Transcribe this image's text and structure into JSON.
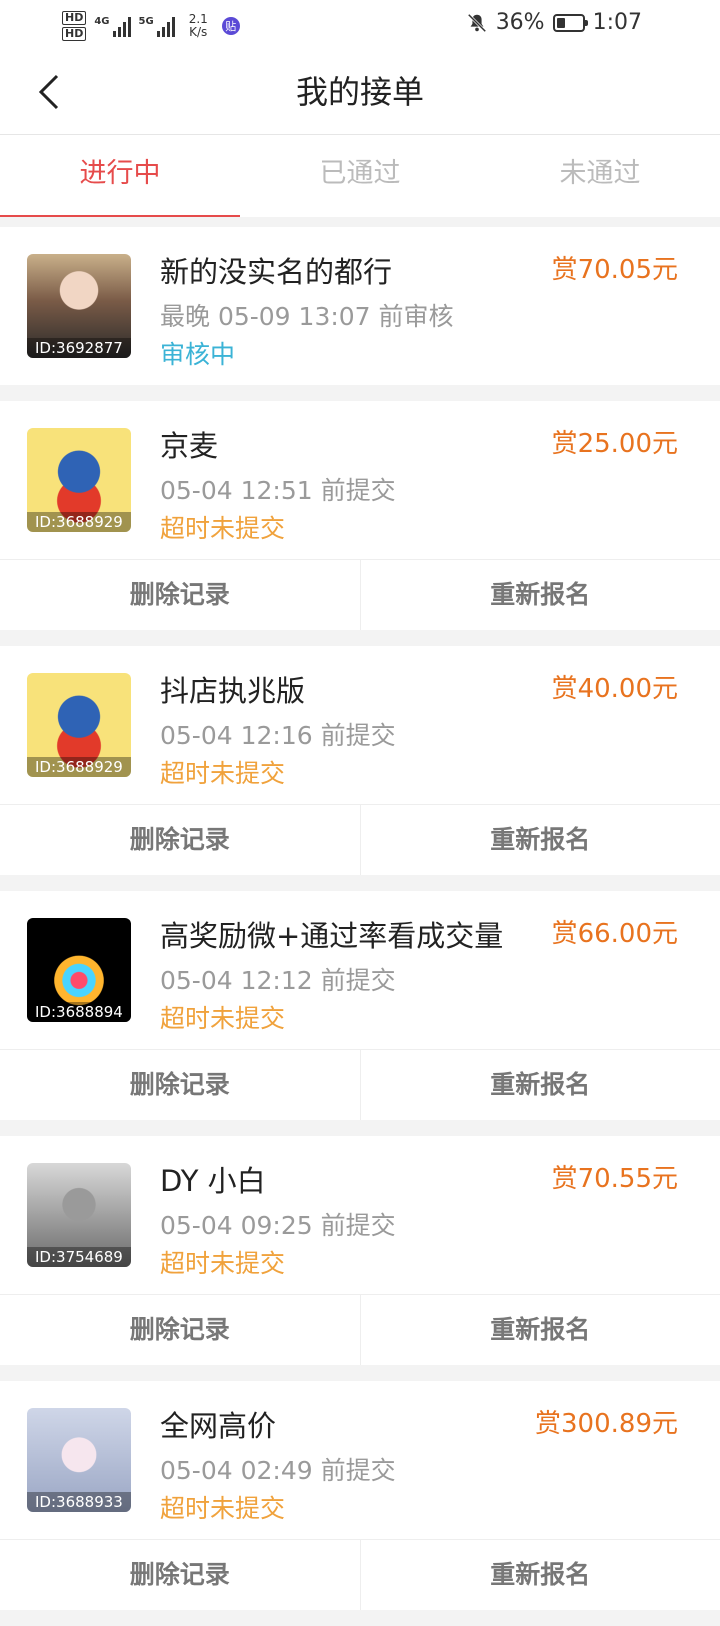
{
  "status_bar": {
    "hd1": "HD",
    "hd2": "HD",
    "sim1": "4G",
    "sim2": "5G",
    "speed_value": "2.1",
    "speed_unit": "K/s",
    "app_badge": "贴",
    "battery": "36%",
    "battery_level": 0.36,
    "time": "1:07"
  },
  "header": {
    "title": "我的接单"
  },
  "tabs": [
    {
      "label": "进行中",
      "active": true
    },
    {
      "label": "已通过",
      "active": false
    },
    {
      "label": "未通过",
      "active": false
    }
  ],
  "orders": [
    {
      "title": "新的没实名的都行",
      "id": "ID:3692877",
      "sub": "最晚 05-09 13:07 前审核",
      "state": "审核中",
      "reward": "赏70.05元",
      "actions": []
    },
    {
      "title": "京麦",
      "id": "ID:3688929",
      "sub": "05-04 12:51 前提交",
      "state": "超时未提交",
      "reward": "赏25.00元",
      "actions": [
        "删除记录",
        "重新报名"
      ]
    },
    {
      "title": "抖店执兆版",
      "id": "ID:3688929",
      "sub": "05-04 12:16 前提交",
      "state": "超时未提交",
      "reward": "赏40.00元",
      "actions": [
        "删除记录",
        "重新报名"
      ]
    },
    {
      "title": "高奖励微+通过率看成交量",
      "id": "ID:3688894",
      "sub": "05-04 12:12 前提交",
      "state": "超时未提交",
      "reward": "赏66.00元",
      "actions": [
        "删除记录",
        "重新报名"
      ]
    },
    {
      "title": "DY 小白",
      "id": "ID:3754689",
      "sub": "05-04 09:25 前提交",
      "state": "超时未提交",
      "reward": "赏70.55元",
      "actions": [
        "删除记录",
        "重新报名"
      ]
    },
    {
      "title": "全网高价",
      "id": "ID:3688933",
      "sub": "05-04 02:49 前提交",
      "state": "超时未提交",
      "reward": "赏300.89元",
      "actions": [
        "删除记录",
        "重新报名"
      ]
    }
  ]
}
